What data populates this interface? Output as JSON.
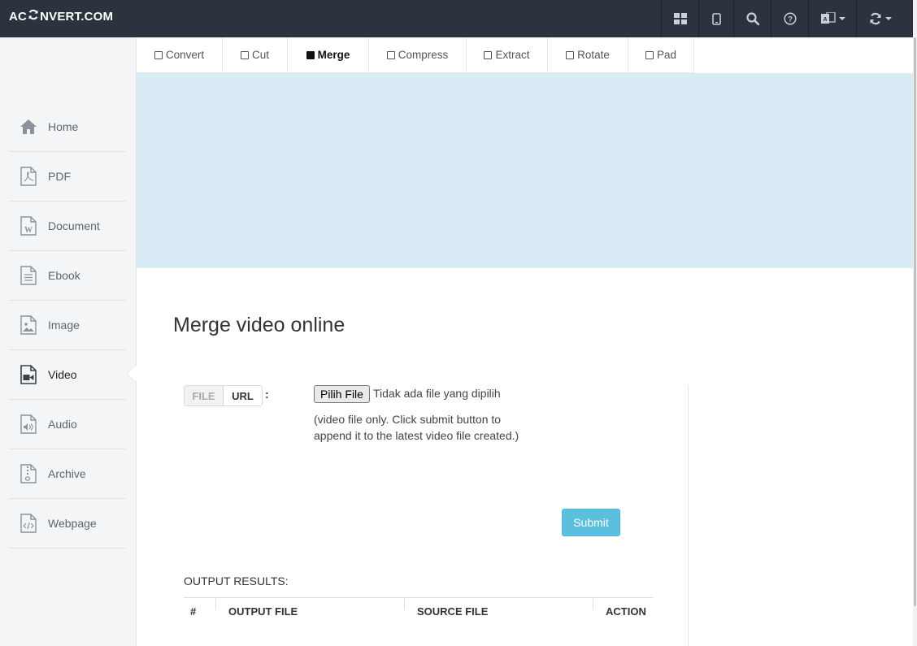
{
  "header": {
    "logo_left": "AC",
    "logo_right": "NVERT.COM",
    "buttons": [
      "grid-icon",
      "tablet-icon",
      "search-icon",
      "help-icon",
      "language-icon",
      "sync-icon"
    ]
  },
  "tabs": [
    {
      "label": "Convert",
      "active": false
    },
    {
      "label": "Cut",
      "active": false
    },
    {
      "label": "Merge",
      "active": true
    },
    {
      "label": "Compress",
      "active": false
    },
    {
      "label": "Extract",
      "active": false
    },
    {
      "label": "Rotate",
      "active": false
    },
    {
      "label": "Pad",
      "active": false
    }
  ],
  "sidebar": {
    "items": [
      {
        "label": "Home",
        "icon": "home-icon"
      },
      {
        "label": "PDF",
        "icon": "pdf-icon"
      },
      {
        "label": "Document",
        "icon": "document-icon"
      },
      {
        "label": "Ebook",
        "icon": "ebook-icon"
      },
      {
        "label": "Image",
        "icon": "image-icon"
      },
      {
        "label": "Video",
        "icon": "video-icon",
        "active": true
      },
      {
        "label": "Audio",
        "icon": "audio-icon"
      },
      {
        "label": "Archive",
        "icon": "archive-icon"
      },
      {
        "label": "Webpage",
        "icon": "webpage-icon"
      }
    ]
  },
  "main": {
    "title": "Merge video online",
    "source_toggle": {
      "file": "FILE",
      "url": "URL",
      "selected": "URL"
    },
    "colon": ":",
    "file_button": "Pilih File",
    "file_status": "Tidak ada file yang dipilih",
    "hint": "(video file only. Click submit button to append it to the latest video file created.)",
    "submit_label": "Submit",
    "output_label": "OUTPUT RESULTS:",
    "table_headers": [
      "#",
      "OUTPUT FILE",
      "SOURCE FILE",
      "ACTION"
    ]
  },
  "colors": {
    "topbar": "#2b333e",
    "ad_background": "#d9ecf5",
    "submit": "#5bc0de"
  }
}
